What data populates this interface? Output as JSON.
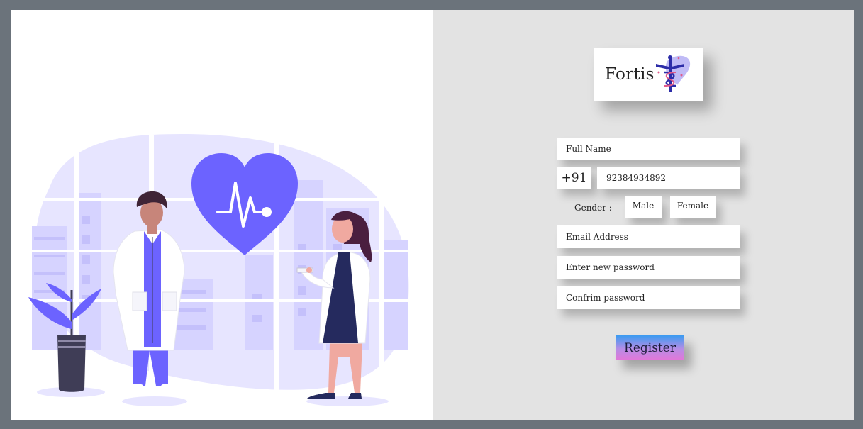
{
  "brand": {
    "name": "Fortis",
    "icon": "caduceus-icon",
    "icon_color": "#2c2ca8",
    "icon_bg_color": "#b9b4f5"
  },
  "illustration": {
    "description_icon": "doctors-heart-illustration",
    "accent_color": "#6c63ff",
    "soft_color": "#e7e5ff"
  },
  "form": {
    "full_name_placeholder": "Full Name",
    "country_code": "+91",
    "phone_value": "92384934892",
    "gender_label": "Gender :",
    "gender_options": [
      "Male",
      "Female"
    ],
    "email_placeholder": "Email Address",
    "password_placeholder": "Enter new password",
    "confirm_password_placeholder": "Confrim password",
    "register_label": "Register"
  },
  "colors": {
    "outer_border": "#6b737b",
    "right_background": "#e3e3e3",
    "register_gradient_top": "#3b9bf1",
    "register_gradient_bottom": "#e376d8"
  }
}
